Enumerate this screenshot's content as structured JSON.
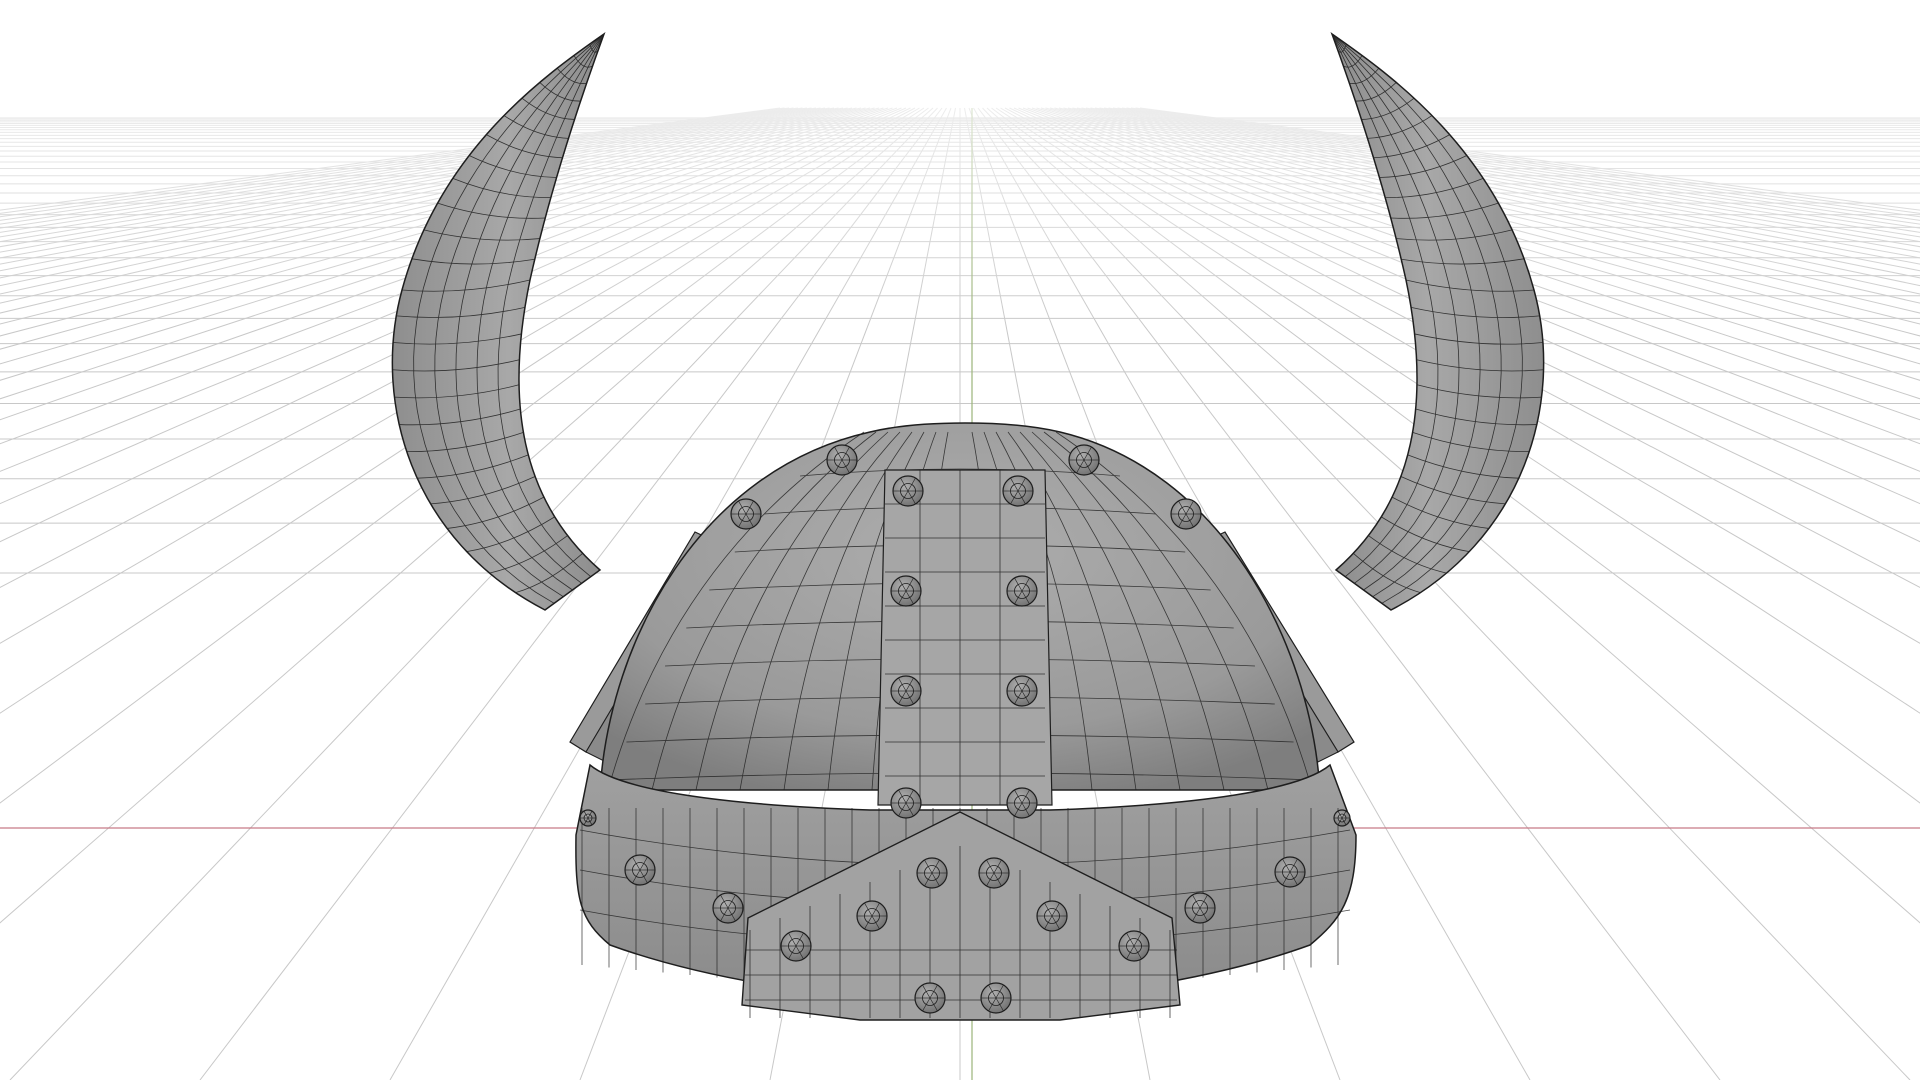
{
  "viewport": {
    "view": "front-perspective",
    "shading": "solid",
    "overlay": "wireframe",
    "background_color": "#ffffff",
    "floor_grid": true,
    "grid_color": "#c8c8c8",
    "x_axis_color": "#c87a86",
    "y_axis_color": "#9bb37a"
  },
  "model": {
    "subject": "horned helmet",
    "surface_color": "#9c9c9c",
    "wire_color": "#1e1e1e",
    "parts": [
      "helmet-dome",
      "helmet-rim",
      "nose-guard",
      "center-band",
      "left-horn",
      "right-horn",
      "rivets"
    ]
  }
}
